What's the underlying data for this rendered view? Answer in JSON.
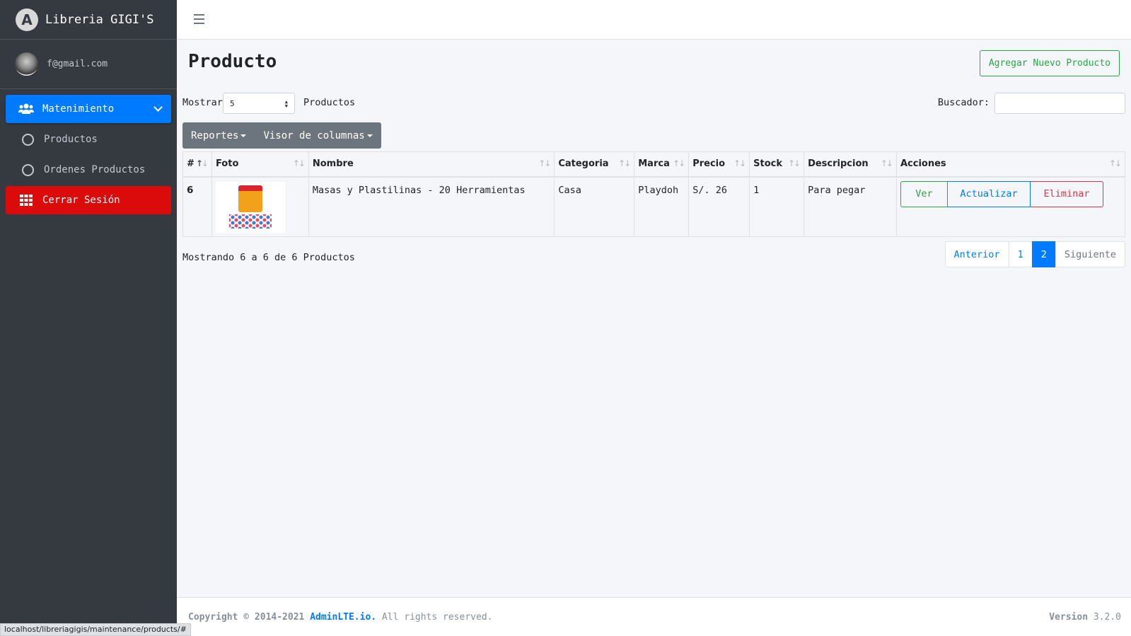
{
  "brand": {
    "name": "Libreria GIGI'S",
    "logo_letter": "A"
  },
  "user": {
    "email": "f@gmail.com"
  },
  "sidebar": {
    "items": [
      {
        "label": "Matenimiento",
        "icon": "users-icon"
      },
      {
        "label": "Productos",
        "icon": "circle-icon"
      },
      {
        "label": "Ordenes Productos",
        "icon": "circle-icon"
      },
      {
        "label": "Cerrar Sesión",
        "icon": "grid-icon"
      }
    ]
  },
  "page": {
    "title": "Producto",
    "new_button": "Agregar Nuevo Producto"
  },
  "controls": {
    "show_label": "Mostrar",
    "page_size": "5",
    "entries_label": "Productos",
    "search_label": "Buscador:",
    "search_value": "",
    "reports_button": "Reportes",
    "columns_button": "Visor de columnas"
  },
  "table": {
    "columns": [
      "#",
      "Foto",
      "Nombre",
      "Categoria",
      "Marca",
      "Precio",
      "Stock",
      "Descripcion",
      "Acciones"
    ],
    "rows": [
      {
        "id": "6",
        "name": "Masas y Plastilinas - 20 Herramientas",
        "category": "Casa",
        "brand": "Playdoh",
        "price": "S/. 26",
        "stock": "1",
        "description": "Para pegar"
      }
    ],
    "actions": {
      "view": "Ver",
      "update": "Actualizar",
      "delete": "Eliminar"
    }
  },
  "pagination": {
    "info": "Mostrando 6 a 6 de 6 Productos",
    "previous": "Anterior",
    "pages": [
      "1",
      "2"
    ],
    "current_page": "2",
    "next": "Siguiente"
  },
  "footer": {
    "copyright": "Copyright © 2014-2021 ",
    "link": "AdminLTE.io.",
    "rights": " All rights reserved.",
    "version_label": "Version",
    "version": " 3.2.0"
  },
  "status_url": "localhost/libreriagigis/maintenance/products/#",
  "colors": {
    "primary": "#007bff",
    "success": "#28a745",
    "danger": "#dc3545",
    "sidebar": "#343a40",
    "logout": "#dc0b0b"
  }
}
